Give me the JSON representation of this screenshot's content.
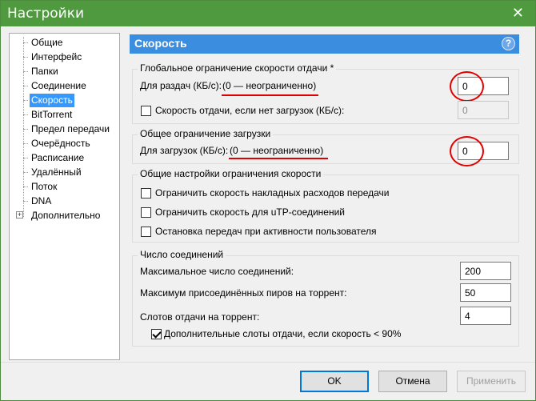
{
  "window": {
    "title": "Настройки"
  },
  "sidebar": {
    "items": [
      {
        "label": "Общие"
      },
      {
        "label": "Интерфейс"
      },
      {
        "label": "Папки"
      },
      {
        "label": "Соединение"
      },
      {
        "label": "Скорость",
        "selected": true
      },
      {
        "label": "BitTorrent"
      },
      {
        "label": "Предел передачи"
      },
      {
        "label": "Очерёдность"
      },
      {
        "label": "Расписание"
      },
      {
        "label": "Удалённый"
      },
      {
        "label": "Поток"
      },
      {
        "label": "DNA"
      },
      {
        "label": "Дополнительно",
        "expandable": true
      }
    ],
    "expander_symbol": "+"
  },
  "page": {
    "title": "Скорость",
    "help_symbol": "?"
  },
  "upload_group": {
    "title": "Глобальное ограничение скорости отдачи *",
    "seeding_label": "Для раздач (КБ/с):",
    "seeding_hint": "(0 — неограниченно)",
    "seeding_value": "0",
    "no_download_label": "Скорость отдачи, если нет загрузок (КБ/с):",
    "no_download_value": "0",
    "no_download_checked": false
  },
  "download_group": {
    "title": "Общее ограничение загрузки",
    "download_label": "Для загрузок (КБ/с):",
    "download_hint": "(0 — неограниченно)",
    "download_value": "0"
  },
  "rate_group": {
    "title": "Общие настройки ограничения скорости",
    "options": [
      {
        "label": "Ограничить скорость накладных расходов передачи",
        "checked": false
      },
      {
        "label": "Ограничить скорость для uTP-соединений",
        "checked": false
      },
      {
        "label": "Остановка передач при активности пользователя",
        "checked": false
      }
    ]
  },
  "connections_group": {
    "title": "Число соединений",
    "max_connections_label": "Максимальное число соединений:",
    "max_connections_value": "200",
    "max_peers_label": "Максимум присоединённых пиров на торрент:",
    "max_peers_value": "50",
    "upload_slots_label": "Слотов отдачи на торрент:",
    "upload_slots_value": "4",
    "extra_slots_label": "Дополнительные слоты отдачи, если скорость < 90%",
    "extra_slots_checked": true
  },
  "buttons": {
    "ok": "OK",
    "cancel": "Отмена",
    "apply": "Применить"
  },
  "colors": {
    "titlebar": "#4f9a3f",
    "header": "#3b8de0",
    "selection": "#3399ff",
    "annotation": "#e00000"
  }
}
